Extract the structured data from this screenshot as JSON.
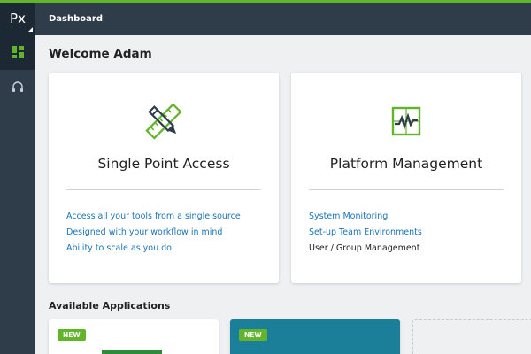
{
  "app": {
    "logo": "Px"
  },
  "topbar": {
    "title": "Dashboard"
  },
  "sidebar": {
    "items": [
      {
        "icon": "dashboard-grid-icon",
        "active": true
      },
      {
        "icon": "headset-icon",
        "active": false
      }
    ]
  },
  "welcome": "Welcome Adam",
  "cards": [
    {
      "icon": "ruler-pencil-icon",
      "title": "Single Point Access",
      "links": [
        "Access all your tools from a single source",
        "Designed with your workflow in mind",
        "Ability to scale as you do"
      ]
    },
    {
      "icon": "monitor-chart-icon",
      "title": "Platform Management",
      "links": [
        "System Monitoring",
        "Set-up Team Environments"
      ],
      "plain_text": "User / Group Management"
    }
  ],
  "available_apps": {
    "title": "Available Applications",
    "apps": [
      {
        "badge": "NEW"
      },
      {
        "badge": "NEW"
      }
    ]
  },
  "colors": {
    "accent_green": "#62b42b",
    "link_blue": "#1a75b6",
    "sidebar": "#2f3d4a",
    "teal_card": "#1b7f9a"
  }
}
